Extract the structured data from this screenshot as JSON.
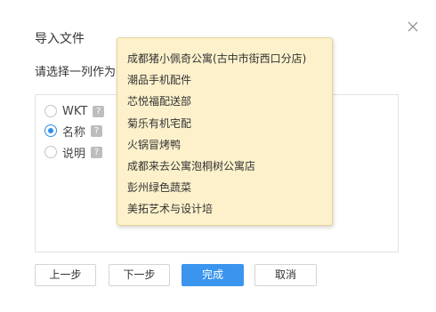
{
  "dialog": {
    "title": "导入文件",
    "close_icon": "close-icon",
    "prompt": "请选择一列作为"
  },
  "columns": [
    {
      "label": "WKT",
      "help": "?",
      "checked": false
    },
    {
      "label": "名称",
      "help": "?",
      "checked": true
    },
    {
      "label": "说明",
      "help": "?",
      "checked": false
    }
  ],
  "tooltip": {
    "items": [
      "成都猪小佩奇公寓(古中市街西口分店)",
      "潮品手机配件",
      "芯悦福配送部",
      "菊乐有机宅配",
      "火锅冒烤鸭",
      "成都来去公寓泡桐树公寓店",
      "彭州绿色蔬菜",
      "美拓艺术与设计培"
    ]
  },
  "footer": {
    "prev_label": "上一步",
    "next_label": "下一步",
    "finish_label": "完成",
    "cancel_label": "取消"
  },
  "colors": {
    "primary": "#3b95ee",
    "tooltip_bg": "#fdf1cb",
    "radio_checked": "#2f8fe8"
  }
}
